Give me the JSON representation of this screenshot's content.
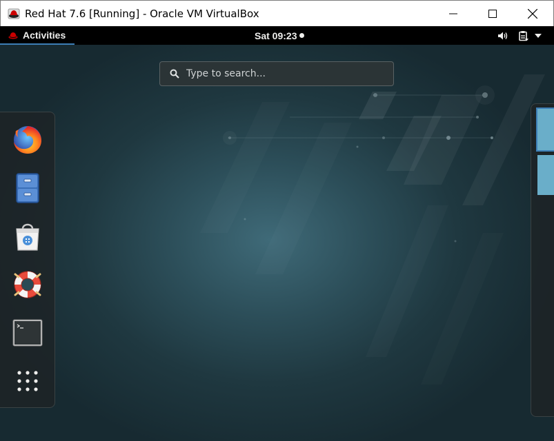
{
  "window": {
    "title": "Red Hat 7.6 [Running] - Oracle VM VirtualBox"
  },
  "topbar": {
    "activities_label": "Activities",
    "clock": "Sat 09:23"
  },
  "search": {
    "placeholder": "Type to search..."
  },
  "dash": {
    "apps": [
      {
        "name": "Firefox",
        "icon": "firefox-icon"
      },
      {
        "name": "Files",
        "icon": "file-cabinet-icon"
      },
      {
        "name": "Software",
        "icon": "shopping-bag-icon"
      },
      {
        "name": "Help",
        "icon": "lifebuoy-icon"
      },
      {
        "name": "Terminal",
        "icon": "terminal-icon"
      },
      {
        "name": "Show Applications",
        "icon": "app-grid-icon"
      }
    ]
  },
  "colors": {
    "accent": "#3d7fb7",
    "topbar": "#000000",
    "wallpaper": "#2c4e59"
  }
}
